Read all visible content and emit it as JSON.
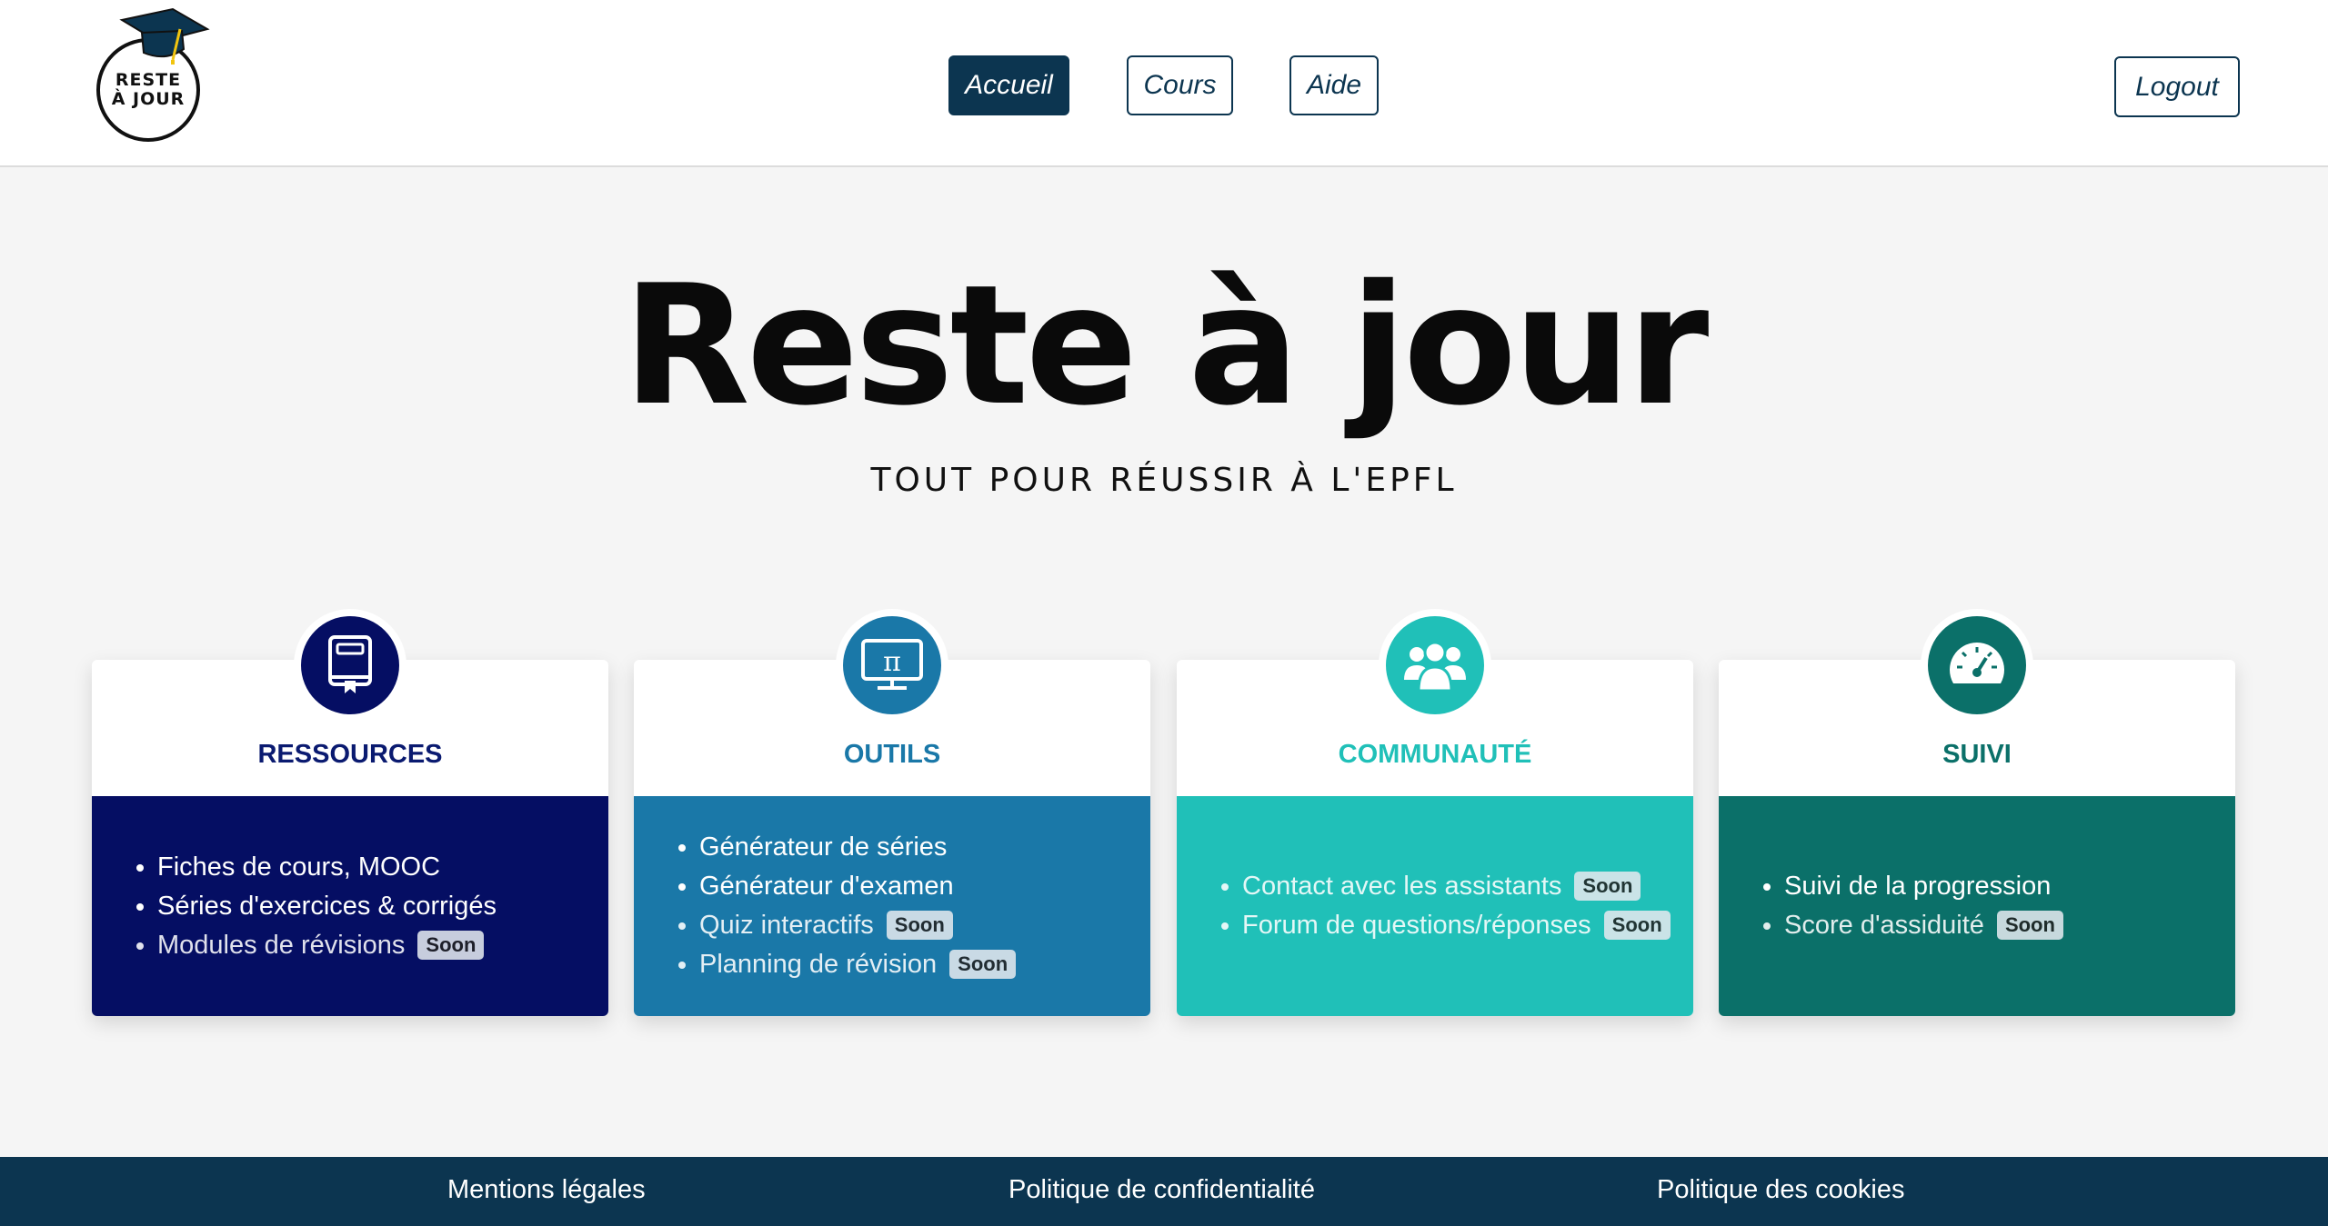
{
  "header": {
    "logo": {
      "line1": "RESTE",
      "line2": "À JOUR"
    },
    "nav": {
      "home": "Accueil",
      "courses": "Cours",
      "help": "Aide"
    },
    "logout": "Logout"
  },
  "hero": {
    "title": "Reste à jour",
    "subtitle": "TOUT POUR RÉUSSIR À L'EPFL"
  },
  "cards": [
    {
      "title": "RESSOURCES",
      "icon": "book-icon",
      "color": "#050e63",
      "title_color": "#0a1a70",
      "items": [
        {
          "label": "Fiches de cours, MOOC"
        },
        {
          "label": "Séries d'exercices & corrigés"
        },
        {
          "label": "Modules de révisions",
          "badge": "Soon"
        }
      ]
    },
    {
      "title": "OUTILS",
      "icon": "pi-monitor-icon",
      "color": "#1a78a8",
      "title_color": "#1a78a8",
      "items": [
        {
          "label": "Générateur de séries"
        },
        {
          "label": "Générateur d'examen"
        },
        {
          "label": "Quiz interactifs",
          "badge": "Soon"
        },
        {
          "label": "Planning de révision",
          "badge": "Soon"
        }
      ]
    },
    {
      "title": "COMMUNAUTÉ",
      "icon": "users-icon",
      "color": "#20c0b8",
      "title_color": "#20c0b8",
      "items": [
        {
          "label": "Contact avec les assistants",
          "badge": "Soon"
        },
        {
          "label": "Forum de questions/réponses",
          "badge": "Soon"
        }
      ]
    },
    {
      "title": "SUIVI",
      "icon": "gauge-icon",
      "color": "#0b7069",
      "title_color": "#0b7069",
      "items": [
        {
          "label": "Suivi de la progression"
        },
        {
          "label": "Score d'assiduité",
          "badge": "Soon"
        }
      ]
    }
  ],
  "footer": {
    "legal": "Mentions légales",
    "privacy": "Politique de confidentialité",
    "cookies": "Politique des cookies"
  }
}
